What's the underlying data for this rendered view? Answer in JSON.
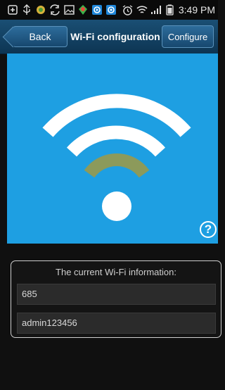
{
  "status_bar": {
    "time": "3:49 PM",
    "icons": [
      "add-icon",
      "usb-icon",
      "app-icon",
      "sync-icon",
      "image-icon",
      "app-icon-2",
      "video-icon",
      "video-icon-2",
      "alarm-icon",
      "wifi-icon",
      "signal-icon",
      "battery-icon"
    ]
  },
  "header": {
    "back_label": "Back",
    "title": "Wi-Fi configuration",
    "configure_label": "Configure"
  },
  "hero": {
    "background": "#1e9fe2",
    "arc_color": "#ffffff",
    "active_arc_color": "#8c9a5b",
    "help_label": "?"
  },
  "wifi_info": {
    "heading": "The current Wi-Fi information:",
    "ssid": "685",
    "password": "admin123456"
  }
}
